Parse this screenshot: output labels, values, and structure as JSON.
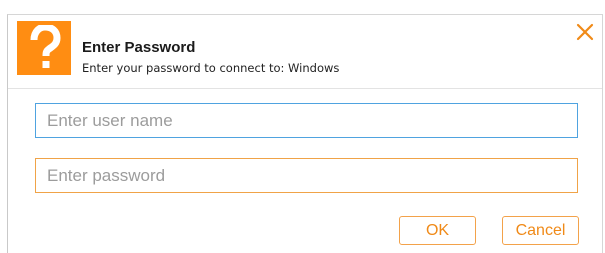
{
  "dialog": {
    "icon": "question-mark-icon",
    "title": "Enter Password",
    "subtitle": "Enter your password to connect to: Windows",
    "close_icon": "close-icon"
  },
  "form": {
    "username_placeholder": "Enter user name",
    "username_value": "",
    "password_placeholder": "Enter password",
    "password_value": ""
  },
  "buttons": {
    "ok_label": "OK",
    "cancel_label": "Cancel"
  },
  "colors": {
    "accent": "#ff8d12",
    "focus_border": "#4fa3e0",
    "button_border": "#f3a24a"
  }
}
